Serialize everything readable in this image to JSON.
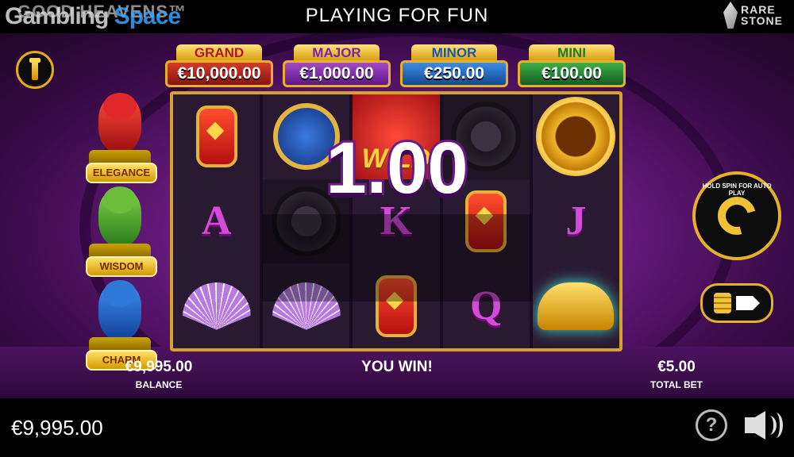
{
  "header": {
    "watermark_left": "Gambling",
    "watermark_right": "Space",
    "game_title": "GOOD HEAVENS™",
    "mode": "PLAYING FOR FUN",
    "brand_line1": "RARE",
    "brand_line2": "STONE"
  },
  "jackpots": [
    {
      "name": "GRAND",
      "amount": "€10,000.00"
    },
    {
      "name": "MAJOR",
      "amount": "€1,000.00"
    },
    {
      "name": "MINOR",
      "amount": "€250.00"
    },
    {
      "name": "MINI",
      "amount": "€100.00"
    }
  ],
  "side_features": [
    "ELEGANCE",
    "WISDOM",
    "CHARM"
  ],
  "reels": {
    "wild_label": "WILD",
    "letters": {
      "r2c1": "A",
      "r2c3": "K",
      "r2c5": "J",
      "r3c4": "Q"
    }
  },
  "win": {
    "amount": "1.00",
    "message": "YOU WIN!"
  },
  "controls": {
    "spin_hint": "HOLD SPIN FOR AUTO PLAY",
    "info_icon": "info-icon",
    "bet_icon": "coins-arrow-icon"
  },
  "stats": {
    "balance_value": "€9,995.00",
    "balance_label": "BALANCE",
    "bet_value": "€5.00",
    "bet_label": "TOTAL BET"
  },
  "footer": {
    "balance": "€9,995.00",
    "help_label": "?"
  }
}
